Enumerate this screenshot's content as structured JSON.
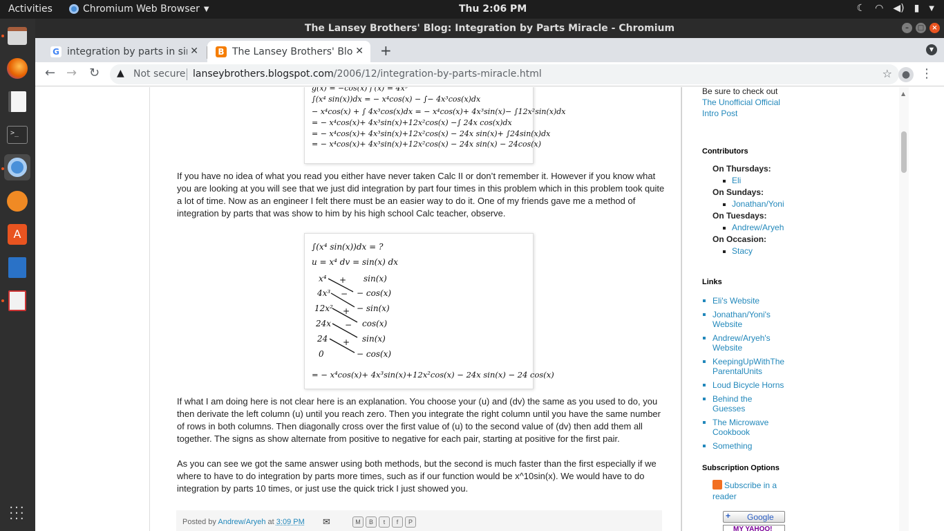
{
  "topbar": {
    "activities": "Activities",
    "app_name": "Chromium Web Browser",
    "clock": "Thu  2:06 PM"
  },
  "window": {
    "title": "The Lansey Brothers' Blog: Integration by Parts Miracle - Chromium"
  },
  "tabs": [
    {
      "label": "integration by parts in sin",
      "favicon": "google-icon",
      "active": false
    },
    {
      "label": "The Lansey Brothers' Blog",
      "favicon": "blogger-icon",
      "active": true
    }
  ],
  "toolbar": {
    "security": "Not secure",
    "url_host": "lanseybrothers.blogspot.com",
    "url_path": "/2006/12/integration-by-parts-miracle.html"
  },
  "post": {
    "math_box_1": {
      "lines": [
        "g(x) = −cos(x)     f′(x) = 4x³",
        "∫(x⁴ sin(x))dx = − x⁴cos(x) − ∫− 4x³cos(x)dx",
        "− x⁴cos(x) + ∫ 4x³cos(x)dx = − x⁴cos(x)+ 4x³sin(x)− ∫12x²sin(x)dx",
        "= − x⁴cos(x)+ 4x³sin(x)+12x²cos(x) −∫ 24x cos(x)dx",
        "= − x⁴cos(x)+ 4x³sin(x)+12x²cos(x) − 24x sin(x)+ ∫24sin(x)dx",
        "= − x⁴cos(x)+ 4x³sin(x)+12x²cos(x) − 24x sin(x) − 24cos(x)"
      ]
    },
    "paragraph_1": "If you have no idea of what you read you either have never taken Calc II or don’t remember it. However if you know what you are looking at you will see that we just did integration by part four times in this problem which in this problem took quite a lot of time. Now as an engineer I felt there must be an easier way to do it. One of my friends gave me a method of integration by parts that was show to him by his high school Calc teacher, observe.",
    "math_box_2": {
      "header_1": "∫(x⁴ sin(x))dx = ?",
      "header_2": "u = x⁴      dv = sin(x) dx",
      "left_column": [
        "x⁴",
        "4x³",
        "12x²",
        "24x",
        "24",
        "0"
      ],
      "right_column": [
        "sin(x)",
        "− cos(x)",
        "− sin(x)",
        "cos(x)",
        "sin(x)",
        "− cos(x)"
      ],
      "signs": [
        "+",
        "−",
        "+",
        "−",
        "+"
      ],
      "result": "= − x⁴cos(x)+ 4x³sin(x)+12x²cos(x) − 24x sin(x) − 24 cos(x)"
    },
    "paragraph_2": "If what I am doing here is not clear here is an explanation. You choose your (u) and (dv) the same as you used to do, you then derivate the left column (u) until you reach zero. Then you integrate the right column until you have the same number of rows in both columns. Then diagonally cross over the first value of (u) to the second value of (dv) then add them all together. The signs as show alternate from positive to negative for each pair, starting at positive for the first pair.",
    "paragraph_3": "As you can see we got the same answer using both methods, but the second is much faster than the first especially if we where to have to do integration by parts more times, such as if our function would be x^10sin(x). We would have to do integration by parts 10 times, or just use the quick trick I just showed you.",
    "footer": {
      "posted_by": "Posted by",
      "author": "Andrew/Aryeh",
      "at": "at",
      "time": "3:09 PM"
    }
  },
  "sidebar": {
    "intro_text": "Be sure to check out",
    "intro_link": "The Unofficial Official Intro Post",
    "contributors_title": "Contributors",
    "contributors": [
      {
        "day": "On Thursdays:",
        "names": [
          "Eli"
        ]
      },
      {
        "day": "On Sundays:",
        "names": [
          "Jonathan/Yoni"
        ]
      },
      {
        "day": "On Tuesdays:",
        "names": [
          "Andrew/Aryeh"
        ]
      },
      {
        "day": "On Occasion:",
        "names": [
          "Stacy"
        ]
      }
    ],
    "links_title": "Links",
    "links": [
      "Eli's Website",
      "Jonathan/Yoni's Website",
      "Andrew/Aryeh's Website",
      "KeepingUpWithTheParentalUnits",
      "Loud Bicycle Horns",
      "Behind the Guesses",
      "The Microwave Cookbook",
      "Something"
    ],
    "subscription_title": "Subscription Options",
    "subscribe_link": "Subscribe in a reader",
    "google_button": "Google",
    "yahoo_button": "MY YAHOO!"
  }
}
